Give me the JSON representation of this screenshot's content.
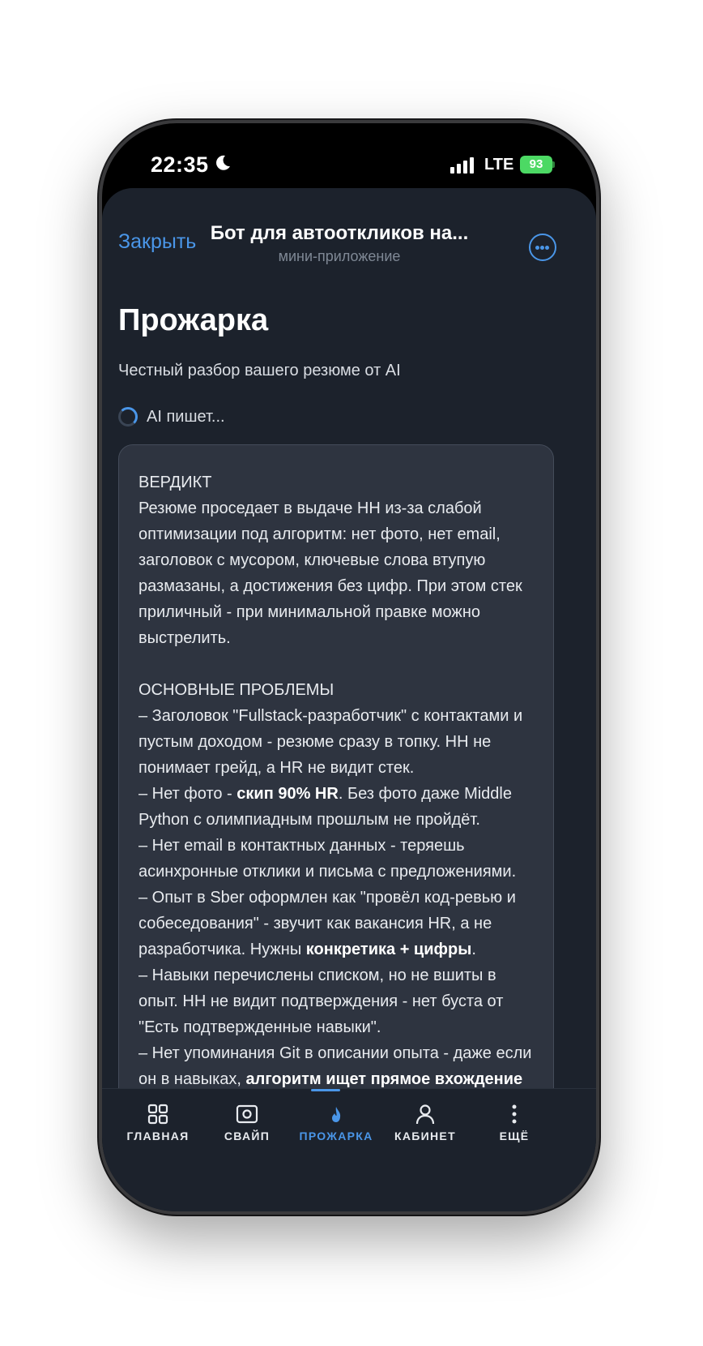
{
  "status_bar": {
    "time": "22:35",
    "network": "LTE",
    "battery": "93"
  },
  "header": {
    "close_label": "Закрыть",
    "title": "Бот для автооткликов на...",
    "subtitle": "мини-приложение"
  },
  "page": {
    "title": "Прожарка",
    "subtitle": "Честный разбор вашего резюме от AI",
    "status": "AI пишет..."
  },
  "card": {
    "verdict_heading": "ВЕРДИКТ",
    "verdict_text": "Резюме проседает в выдаче HH из-за слабой оптимизации под алгоритм: нет фото, нет email, заголовок с мусором, ключевые слова втупую размазаны, а достижения без цифр. При этом стек приличный - при минимальной правке можно выстрелить.",
    "problems_heading": "ОСНОВНЫЕ ПРОБЛЕМЫ",
    "problem_1": "– Заголовок \"Fullstack-разработчик\" с контактами и пустым доходом - резюме сразу в топку. HH не понимает грейд, а HR не видит стек.",
    "problem_2_a": "– Нет фото - ",
    "problem_2_bold": "скип 90% HR",
    "problem_2_b": ". Без фото даже Middle Python с олимпиадным прошлым не пройдёт.",
    "problem_3": "– Нет email в контактных данных - теряешь асинхронные отклики и письма с предложениями.",
    "problem_4_a": "– Опыт в Sber оформлен как \"провёл код-ревью и собеседования\" - звучит как вакансия HR, а не разработчика. Нужны ",
    "problem_4_bold": "конкретика + цифры",
    "problem_4_b": ".",
    "problem_5": "– Навыки перечислены списком, но не вшиты в опыт. HH не видит подтверждения - нет буста от \"Есть подтвержденные навыки\".",
    "problem_6_a": "– Нет упоминания Git в описании опыта - даже если он в навыках, ",
    "problem_6_bold": "алгоритм ищет прямое вхождение"
  },
  "tabs": [
    {
      "label": "ГЛАВНАЯ",
      "icon": "grid-icon"
    },
    {
      "label": "СВАЙП",
      "icon": "swipe-card-icon"
    },
    {
      "label": "ПРОЖАРКА",
      "icon": "flame-icon",
      "active": true
    },
    {
      "label": "КАБИНЕТ",
      "icon": "person-icon"
    },
    {
      "label": "ЕЩЁ",
      "icon": "more-vertical-icon"
    }
  ],
  "colors": {
    "accent": "#4a96e8",
    "background": "#1c222c",
    "card": "#2e3440",
    "battery": "#4cd964"
  }
}
